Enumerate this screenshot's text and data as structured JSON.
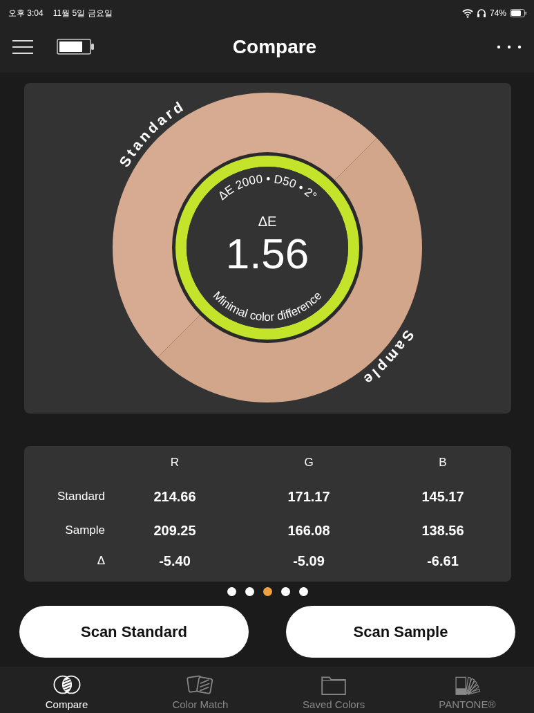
{
  "status_bar": {
    "time": "오후 3:04",
    "date": "11월 5일 금요일",
    "battery": "74%"
  },
  "header": {
    "title": "Compare"
  },
  "gauge": {
    "metric": "ΔE 2000 • D50 • 2°",
    "label": "ΔE",
    "value": "1.56",
    "verdict": "Minimal color difference",
    "swatches": [
      {
        "label": "Standard",
        "color": "#d6ab91"
      },
      {
        "label": "Sample",
        "color": "#d1a68a"
      }
    ]
  },
  "table": {
    "columns": [
      "R",
      "G",
      "B"
    ],
    "rows": [
      {
        "label": "Standard",
        "values": [
          "214.66",
          "171.17",
          "145.17"
        ]
      },
      {
        "label": "Sample",
        "values": [
          "209.25",
          "166.08",
          "138.56"
        ]
      },
      {
        "label": "Δ",
        "values": [
          "-5.40",
          "-5.09",
          "-6.61"
        ]
      }
    ]
  },
  "page_dots": [
    {
      "selected": false
    },
    {
      "selected": false
    },
    {
      "selected": true
    },
    {
      "selected": false
    },
    {
      "selected": false
    }
  ],
  "buttons": [
    "Scan Standard",
    "Scan Sample"
  ],
  "tabs": [
    {
      "label": "Compare",
      "kind": "compare",
      "selected": true
    },
    {
      "label": "Color Match",
      "kind": "match",
      "selected": false
    },
    {
      "label": "Saved Colors",
      "kind": "folder",
      "selected": false
    },
    {
      "label": "PANTONE®",
      "kind": "fan",
      "selected": false
    }
  ]
}
